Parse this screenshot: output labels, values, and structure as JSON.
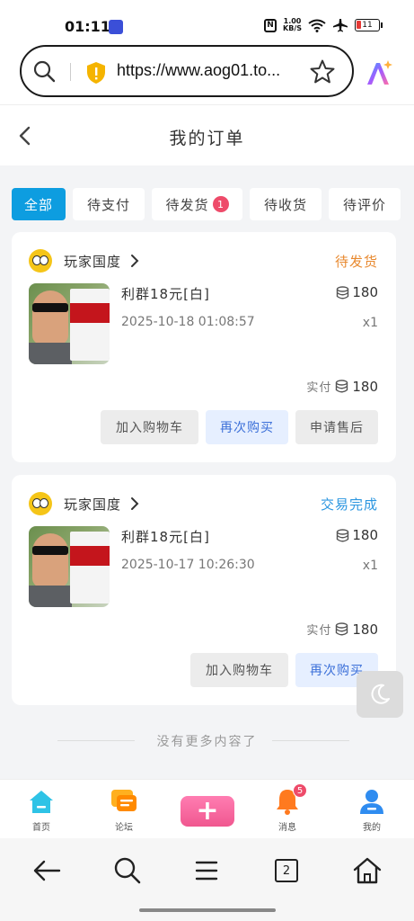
{
  "status_bar": {
    "time": "01:11",
    "nfc": "N",
    "net_speed_value": "1.00",
    "net_speed_unit": "KB/S",
    "battery": "11"
  },
  "browser": {
    "url": "https://www.aog01.to..."
  },
  "header": {
    "title": "我的订单"
  },
  "tabs": [
    {
      "label": "全部",
      "active": true
    },
    {
      "label": "待支付"
    },
    {
      "label": "待发货",
      "badge": "1"
    },
    {
      "label": "待收货"
    },
    {
      "label": "待评价"
    }
  ],
  "orders": [
    {
      "shop": "玩家国度",
      "status": "待发货",
      "status_color": "#e8892f",
      "product": "利群18元[白]",
      "date": "2025-10-18 01:08:57",
      "price": "180",
      "qty": "x1",
      "paid_label": "实付",
      "paid": "180",
      "buttons": [
        "加入购物车",
        "再次购买",
        "申请售后"
      ]
    },
    {
      "shop": "玩家国度",
      "status": "交易完成",
      "status_color": "#2b96e0",
      "product": "利群18元[白]",
      "date": "2025-10-17 10:26:30",
      "price": "180",
      "qty": "x1",
      "paid_label": "实付",
      "paid": "180",
      "buttons": [
        "加入购物车",
        "再次购买"
      ]
    }
  ],
  "end_text": "没有更多内容了",
  "app_nav": [
    {
      "label": "首页",
      "icon": "home-icon"
    },
    {
      "label": "论坛",
      "icon": "forum-icon"
    },
    {
      "label": "",
      "icon": "plus-icon"
    },
    {
      "label": "消息",
      "icon": "bell-icon",
      "badge": "5"
    },
    {
      "label": "我的",
      "icon": "user-icon"
    }
  ],
  "system_nav": {
    "tab_count": "2"
  },
  "colors": {
    "accent": "#0d9de0",
    "badge": "#ee4b6a",
    "pending_status": "#e8892f",
    "completed_status": "#2b96e0"
  }
}
